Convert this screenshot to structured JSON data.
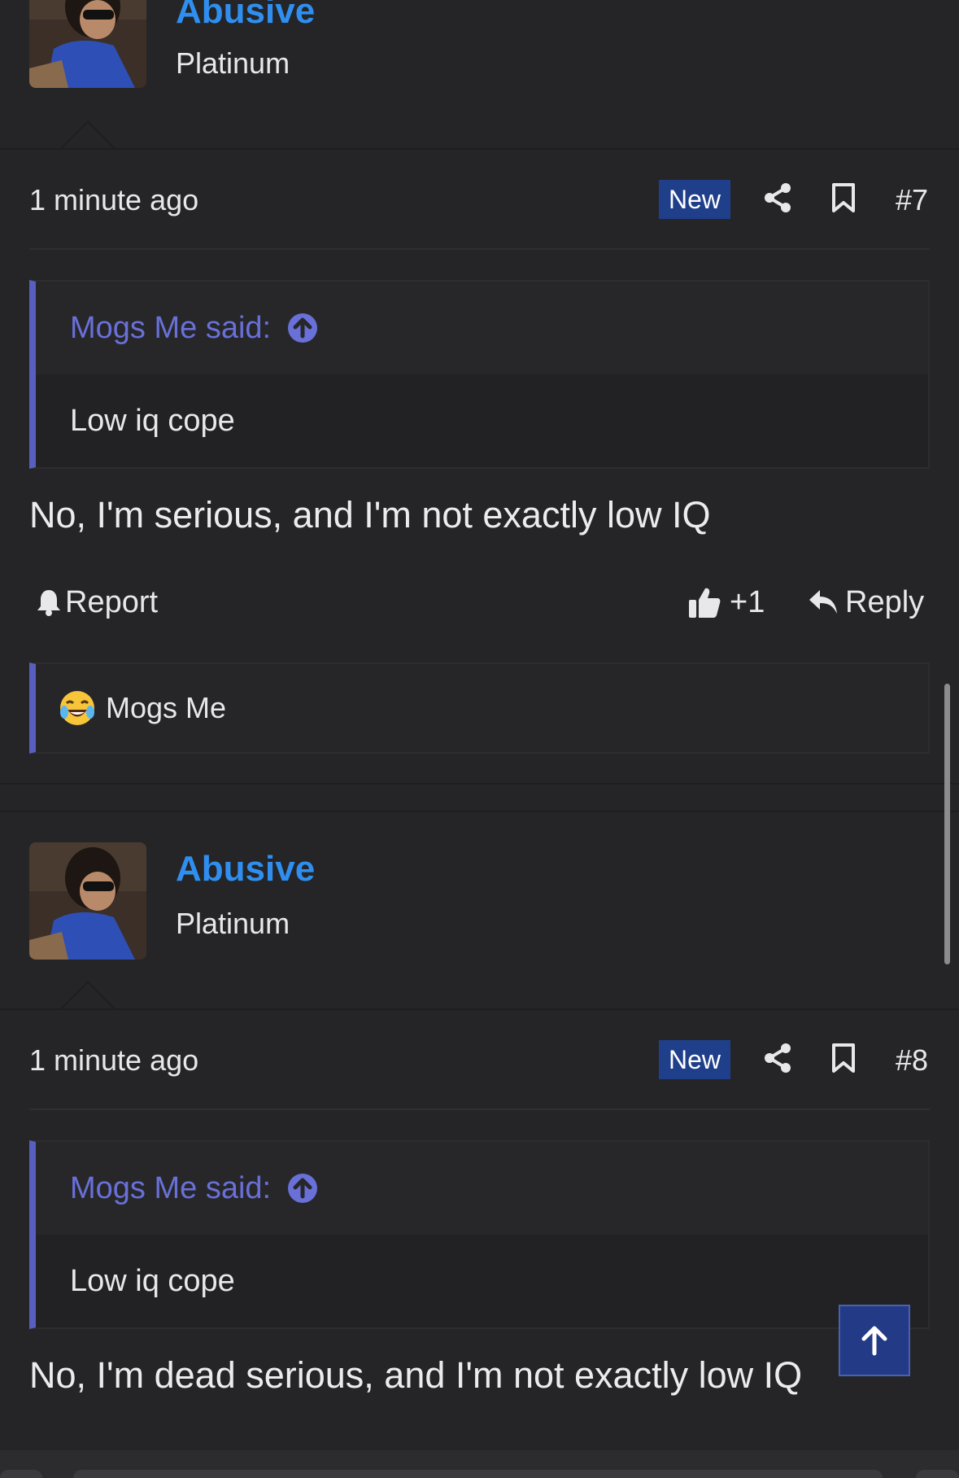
{
  "posts": [
    {
      "author": "Abusive",
      "rank": "Platinum",
      "time": "1 minute ago",
      "badge": "New",
      "number": "#7",
      "quote_author": "Mogs Me said:",
      "quote_text": "Low iq cope",
      "text": "No, I'm serious, and I'm not exactly low IQ",
      "report_label": "Report",
      "like_count": "+1",
      "reply_label": "Reply",
      "reaction_user": "Mogs Me",
      "reaction_icon": "crying-laughing-emoji"
    },
    {
      "author": "Abusive",
      "rank": "Platinum",
      "time": "1 minute ago",
      "badge": "New",
      "number": "#8",
      "quote_author": "Mogs Me said:",
      "quote_text": "Low iq cope",
      "text": "No, I'm dead serious, and I'm not exactly low IQ"
    }
  ],
  "colors": {
    "background": "#252527",
    "username": "#2f8ff0",
    "quote_accent": "#5760c0",
    "badge": "#1f3f8a"
  },
  "icons": [
    "share-icon",
    "bookmark-icon",
    "bell-icon",
    "thumbs-up-icon",
    "reply-icon",
    "arrow-up-icon"
  ]
}
